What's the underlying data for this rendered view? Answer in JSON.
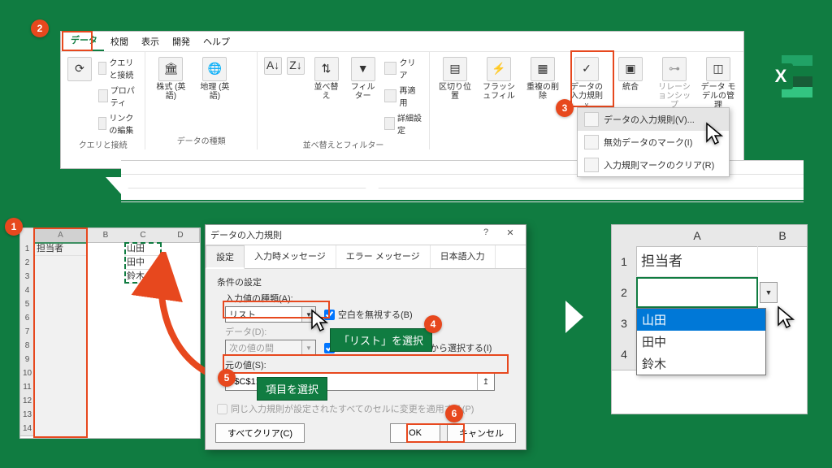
{
  "badges": [
    "1",
    "2",
    "3",
    "4",
    "5",
    "6"
  ],
  "tabs": [
    "データ",
    "校閲",
    "表示",
    "開発",
    "ヘルプ"
  ],
  "ribbon": {
    "group1": {
      "name": "クエリと接続",
      "items": [
        "クエリと接続",
        "プロパティ",
        "リンクの編集"
      ]
    },
    "group2": {
      "name": "データの種類",
      "stocks": "株式 (英語)",
      "geo": "地理 (英語)"
    },
    "group3": {
      "name": "並べ替えとフィルター",
      "sort": "並べ替え",
      "filter": "フィルター",
      "clear": "クリア",
      "reapply": "再適用",
      "adv": "詳細設定"
    },
    "group4": {
      "texttocols": "区切り位置",
      "flash": "フラッシュフィル",
      "dup": "重複の削除",
      "valid": "データの入力規則",
      "consol": "統合",
      "rel": "リレーションシップ",
      "model": "データ モデルの管理"
    }
  },
  "ddmenu": {
    "i1": "データの入力規則(V)...",
    "i2": "無効データのマーク(I)",
    "i3": "入力規則マークのクリア(R)"
  },
  "sheet1": {
    "cols": [
      "A",
      "B",
      "C",
      "D"
    ],
    "a1": "担当者",
    "c1": "山田",
    "c2": "田中",
    "c3": "鈴木"
  },
  "dialog": {
    "title": "データの入力規則",
    "tabs": [
      "設定",
      "入力時メッセージ",
      "エラー メッセージ",
      "日本語入力"
    ],
    "section": "条件の設定",
    "allow_label": "入力値の種類(A):",
    "allow_value": "リスト",
    "ignore_blank": "空白を無視する(B)",
    "incell": "ドロップダウン リストから選択する(I)",
    "data_label": "データ(D):",
    "data_value": "次の値の間",
    "source_label": "元の値(S):",
    "source_value": "=$C$1:$C$3",
    "apply": "同じ入力規則が設定されたすべてのセルに変更を適用する(P)",
    "clear": "すべてクリア(C)",
    "ok": "OK",
    "cancel": "キャンセル"
  },
  "notes": {
    "n4": "「リスト」を選択",
    "n5": "項目を選択"
  },
  "result": {
    "colA": "A",
    "colB": "B",
    "a1": "担当者",
    "opts": [
      "山田",
      "田中",
      "鈴木"
    ]
  }
}
